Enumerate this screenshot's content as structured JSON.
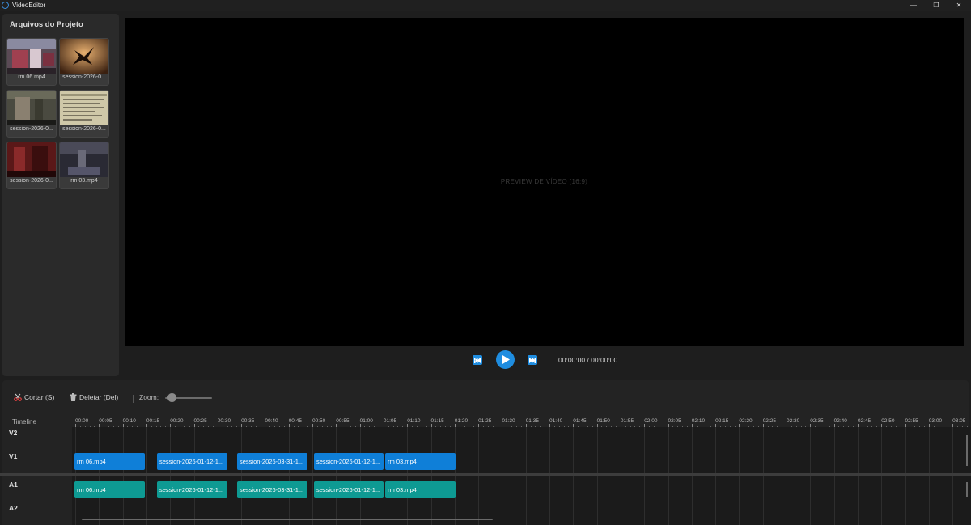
{
  "app": {
    "title": "VideoEditor",
    "minimize": "—",
    "maximize": "❐",
    "close": "✕"
  },
  "project_panel": {
    "title": "Arquivos do Projeto",
    "files": [
      {
        "name": "rm 06.mp4"
      },
      {
        "name": "session-2026-0..."
      },
      {
        "name": "session-2026-0..."
      },
      {
        "name": "session-2026-0..."
      },
      {
        "name": "session-2026-0..."
      },
      {
        "name": "rm 03.mp4"
      }
    ]
  },
  "preview": {
    "label": "PREVIEW DE VÍDEO (16:9)"
  },
  "transport": {
    "time": "00:00:00 / 00:00:00"
  },
  "toolbar": {
    "cut_label": "Cortar (S)",
    "delete_label": "Deletar (Del)",
    "zoom_label": "Zoom:",
    "zoom_level": 0.08
  },
  "timeline": {
    "label": "Timeline",
    "ticks": [
      "00:00",
      "00:05",
      "00:10",
      "00:15",
      "00:20",
      "00:25",
      "00:30",
      "00:35",
      "00:40",
      "00:45",
      "00:50",
      "00:55",
      "01:00",
      "01:05",
      "01:10",
      "01:15",
      "01:20",
      "01:25",
      "01:30",
      "01:35",
      "01:40",
      "01:45",
      "01:50",
      "01:55",
      "02:00",
      "02:05",
      "02:10",
      "02:15",
      "02:20",
      "02:25",
      "02:30",
      "02:35",
      "02:40",
      "02:45",
      "02:50",
      "02:55",
      "03:00",
      "03:05"
    ],
    "tracks": {
      "v2": "V2",
      "v1": "V1",
      "a1": "A1",
      "a2": "A2"
    },
    "video_clips": [
      {
        "label": "rm 06.mp4"
      },
      {
        "label": "session-2026-01-12-1..."
      },
      {
        "label": "session-2026-03-31-1..."
      },
      {
        "label": "session-2026-01-12-1..."
      },
      {
        "label": "rm 03.mp4"
      }
    ],
    "audio_clips": [
      {
        "label": "rm 06.mp4"
      },
      {
        "label": "session-2026-01-12-1..."
      },
      {
        "label": "session-2026-03-31-1..."
      },
      {
        "label": "session-2026-01-12-1..."
      },
      {
        "label": "rm 03.mp4"
      }
    ]
  },
  "colors": {
    "accent": "#0f7fd8",
    "video_clip": "#0f7fd8",
    "audio_clip": "#0e9a93",
    "background": "#1e1e1e"
  }
}
